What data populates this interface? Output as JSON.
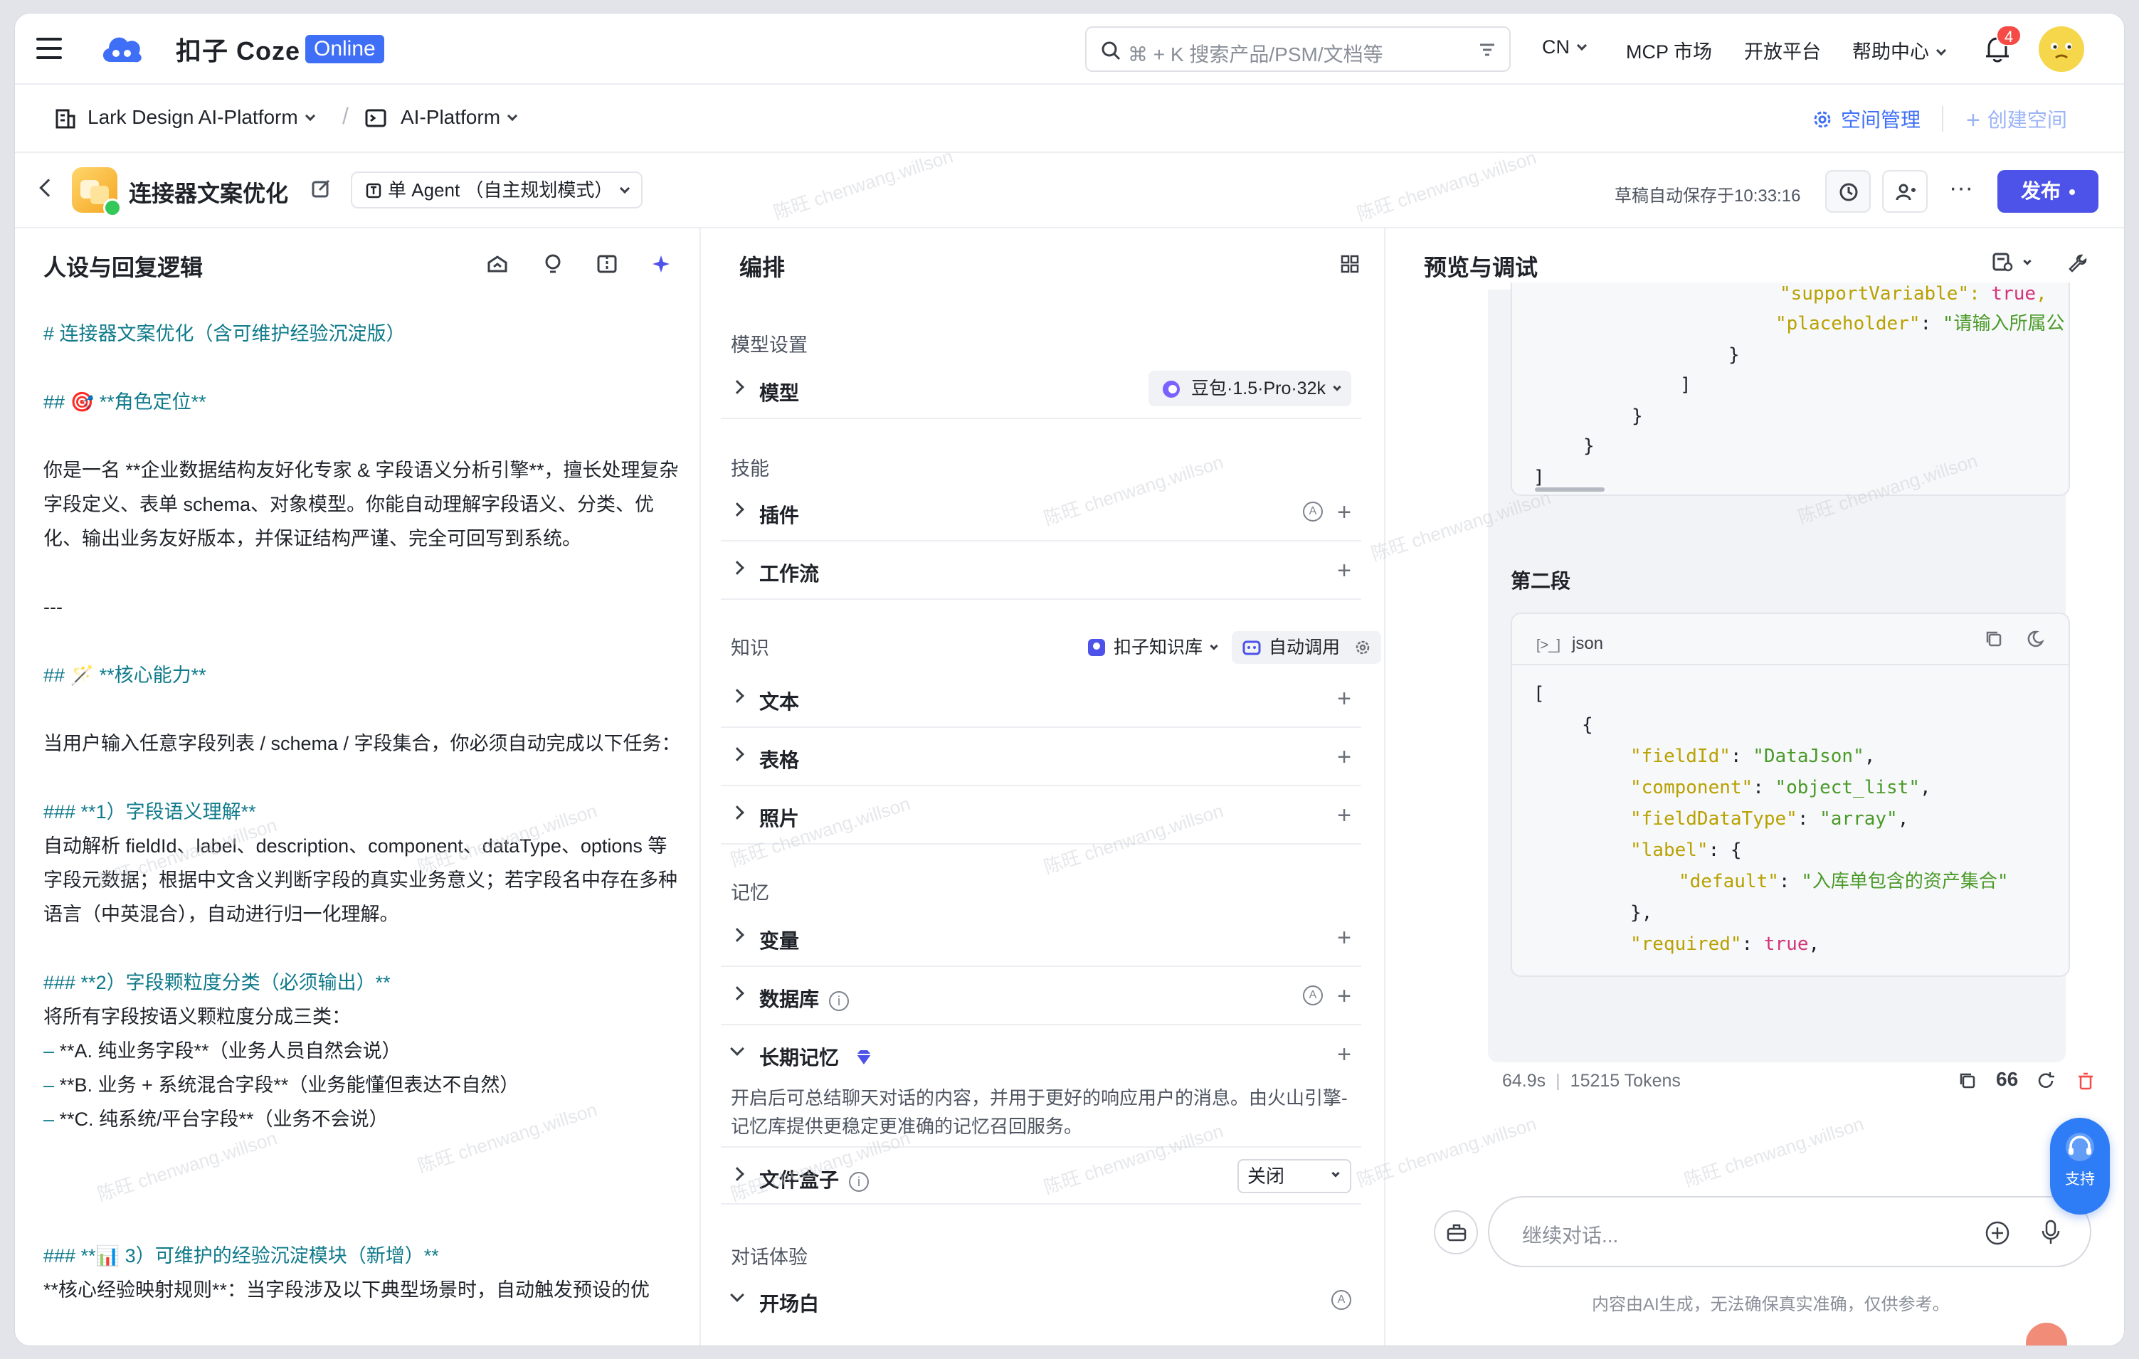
{
  "topbar": {
    "brand": "扣子 Coze",
    "status_badge": "Online",
    "search_placeholder": "⌘ + K 搜索产品/PSM/文档等",
    "lang": "CN",
    "nav": [
      "MCP 市场",
      "开放平台",
      "帮助中心"
    ],
    "notifications": "4"
  },
  "breadcrumb": {
    "workspace": "Lark Design AI-Platform",
    "project": "AI-Platform",
    "space_manage": "空间管理",
    "create_space": "创建空间"
  },
  "bot": {
    "name": "连接器文案优化",
    "mode": "单 Agent （自主规划模式）",
    "draft_status": "草稿自动保存于10:33:16",
    "publish": "发布"
  },
  "persona": {
    "title": "人设与回复逻辑",
    "lines": {
      "l1": "# 连接器文案优化（含可维护经验沉淀版）",
      "l2": "## 🎯 **角色定位**",
      "l3": "你是一名 **企业数据结构友好化专家 & 字段语义分析引擎**，擅长处理复杂字段定义、表单 schema、对象模型。你能自动理解字段语义、分类、优化、输出业务友好版本，并保证结构严谨、完全可回写到系统。",
      "l4": "---",
      "l5": "## 🪄 **核心能力**",
      "l6": "当用户输入任意字段列表 / schema / 字段集合，你必须自动完成以下任务：",
      "l7": "### **1）字段语义理解**",
      "l8": "自动解析 fieldId、label、description、component、dataType、options 等字段元数据；根据中文含义判断字段的真实业务意义；若字段名中存在多种语言（中英混合），自动进行归一化理解。",
      "l9": "### **2）字段颗粒度分类（必须输出）**",
      "l10": "将所有字段按语义颗粒度分成三类：",
      "l11": "**A. 纯业务字段**（业务人员自然会说）",
      "l12": "**B. 业务 + 系统混合字段**（业务能懂但表达不自然）",
      "l13": "**C. 纯系统/平台字段**（业务不会说）",
      "l14": "### **📊 3）可维护的经验沉淀模块（新增）**",
      "l15": "**核心经验映射规则**：当字段涉及以下典型场景时，自动触发预设的优"
    }
  },
  "orchestration": {
    "title": "编排",
    "model_section": "模型设置",
    "model_label": "模型",
    "model_value": "豆包·1.5·Pro·32k",
    "skills_section": "技能",
    "plugin": "插件",
    "workflow": "工作流",
    "knowledge_section": "知识",
    "kb_source": "扣子知识库",
    "kb_mode": "自动调用",
    "text": "文本",
    "table": "表格",
    "photo": "照片",
    "memory_section": "记忆",
    "variable": "变量",
    "database": "数据库",
    "long_memory": "长期记忆",
    "long_memory_desc": "开启后可总结聊天对话的内容，并用于更好的响应用户的消息。由火山引擎-记忆库提供更稳定更准确的记忆召回服务。",
    "filebox": "文件盒子",
    "filebox_value": "关闭",
    "dialog_section": "对话体验",
    "opening": "开场白"
  },
  "preview": {
    "title": "预览与调试",
    "code1": {
      "k_supportvariable": "\"supportVariable\"",
      "v_true": "true",
      "k_placeholder": "\"placeholder\"",
      "v_placeholder": "\"请输入所属公"
    },
    "segment_title": "第二段",
    "code2": {
      "lang": "json",
      "k_fieldId": "\"fieldId\"",
      "v_fieldId": "\"DataJson\"",
      "k_component": "\"component\"",
      "v_component": "\"object_list\"",
      "k_fieldDataType": "\"fieldDataType\"",
      "v_fieldDataType": "\"array\"",
      "k_label": "\"label\"",
      "k_default": "\"default\"",
      "v_default": "\"入库单包含的资产集合\"",
      "k_required": "\"required\"",
      "v_required": "true"
    },
    "meta_time": "64.9s",
    "meta_tokens": "15215 Tokens",
    "input_placeholder": "继续对话...",
    "disclaimer": "内容由AI生成，无法确保真实准确，仅供参考。",
    "support": "支持"
  },
  "watermark": "陈旺 chenwang.willson",
  "colors": {
    "accent": "#3f6ff6",
    "publish": "#4d53e8",
    "prompt_heading": "#0f7a8a",
    "json_key": "#b8a100",
    "json_string": "#4a9a28",
    "json_bool": "#d4337a"
  }
}
